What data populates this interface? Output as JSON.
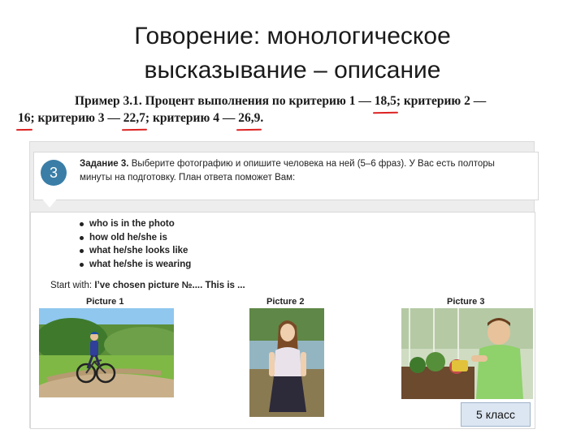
{
  "slide": {
    "title_line1": "Говорение: монологическое",
    "title_line2": "высказывание – описание",
    "grade_badge": "5 класс"
  },
  "example": {
    "line1_prefix": "Пример 3.1. Процент выполнения по критерию 1 — ",
    "crit1": "18,5",
    "line1_mid": "; критерию 2 —",
    "crit2": "16",
    "line2_mid1": "; критерию 3 — ",
    "crit3": "22,7",
    "line2_mid2": "; критерию 4 — ",
    "crit4": "26,9",
    "line2_end": "."
  },
  "task": {
    "number": "3",
    "label": "Задание 3.",
    "text_line1": " Выберите фотографию и опишите человека на ней (5–6 фраз). У Вас есть полторы",
    "text_line2": "минуты на подготовку. План ответа поможет Вам:"
  },
  "plan": [
    "who is in the photo",
    "how old he/she is",
    "what he/she looks like",
    "what he/she is wearing"
  ],
  "start_with": {
    "prefix": "Start with: ",
    "phrase": "I’ve chosen picture №.... This is ..."
  },
  "pictures": [
    {
      "label": "Picture 1"
    },
    {
      "label": "Picture 2"
    },
    {
      "label": "Picture 3"
    }
  ]
}
